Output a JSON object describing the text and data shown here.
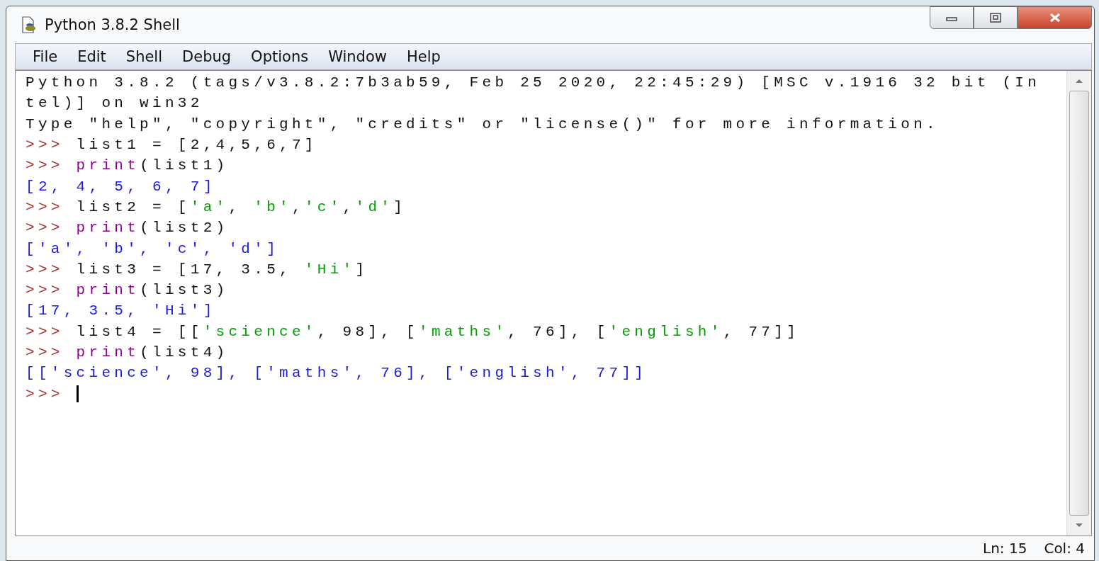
{
  "window": {
    "title": "Python 3.8.2 Shell"
  },
  "menu": [
    "File",
    "Edit",
    "Shell",
    "Debug",
    "Options",
    "Window",
    "Help"
  ],
  "shell_lines": [
    [
      {
        "kind": "plain",
        "text": "Python 3.8.2 (tags/v3.8.2:7b3ab59, Feb 25 2020, 22:45:29) [MSC v.1916 32 bit (In"
      }
    ],
    [
      {
        "kind": "plain",
        "text": "tel)] on win32"
      }
    ],
    [
      {
        "kind": "plain",
        "text": "Type \"help\", \"copyright\", \"credits\" or \"license()\" for more information."
      }
    ],
    [
      {
        "kind": "prompt",
        "text": ">>> "
      },
      {
        "kind": "plain",
        "text": "list1 = [2,4,5,6,7]"
      }
    ],
    [
      {
        "kind": "prompt",
        "text": ">>> "
      },
      {
        "kind": "builtin",
        "text": "print"
      },
      {
        "kind": "plain",
        "text": "(list1)"
      }
    ],
    [
      {
        "kind": "output",
        "text": "[2, 4, 5, 6, 7]"
      }
    ],
    [
      {
        "kind": "prompt",
        "text": ">>> "
      },
      {
        "kind": "plain",
        "text": "list2 = ["
      },
      {
        "kind": "string",
        "text": "'a'"
      },
      {
        "kind": "plain",
        "text": ", "
      },
      {
        "kind": "string",
        "text": "'b'"
      },
      {
        "kind": "plain",
        "text": ","
      },
      {
        "kind": "string",
        "text": "'c'"
      },
      {
        "kind": "plain",
        "text": ","
      },
      {
        "kind": "string",
        "text": "'d'"
      },
      {
        "kind": "plain",
        "text": "]"
      }
    ],
    [
      {
        "kind": "prompt",
        "text": ">>> "
      },
      {
        "kind": "builtin",
        "text": "print"
      },
      {
        "kind": "plain",
        "text": "(list2)"
      }
    ],
    [
      {
        "kind": "output",
        "text": "['a', 'b', 'c', 'd']"
      }
    ],
    [
      {
        "kind": "prompt",
        "text": ">>> "
      },
      {
        "kind": "plain",
        "text": "list3 = [17, 3.5, "
      },
      {
        "kind": "string",
        "text": "'Hi'"
      },
      {
        "kind": "plain",
        "text": "]"
      }
    ],
    [
      {
        "kind": "prompt",
        "text": ">>> "
      },
      {
        "kind": "builtin",
        "text": "print"
      },
      {
        "kind": "plain",
        "text": "(list3)"
      }
    ],
    [
      {
        "kind": "output",
        "text": "[17, 3.5, 'Hi']"
      }
    ],
    [
      {
        "kind": "prompt",
        "text": ">>> "
      },
      {
        "kind": "plain",
        "text": "list4 = [["
      },
      {
        "kind": "string",
        "text": "'science'"
      },
      {
        "kind": "plain",
        "text": ", 98], ["
      },
      {
        "kind": "string",
        "text": "'maths'"
      },
      {
        "kind": "plain",
        "text": ", 76], ["
      },
      {
        "kind": "string",
        "text": "'english'"
      },
      {
        "kind": "plain",
        "text": ", 77]]"
      }
    ],
    [
      {
        "kind": "prompt",
        "text": ">>> "
      },
      {
        "kind": "builtin",
        "text": "print"
      },
      {
        "kind": "plain",
        "text": "(list4)"
      }
    ],
    [
      {
        "kind": "output",
        "text": "[['science', 98], ['maths', 76], ['english', 77]]"
      }
    ],
    [
      {
        "kind": "prompt",
        "text": ">>> "
      }
    ]
  ],
  "status_bar": {
    "line": "Ln: 15",
    "column": "Col: 4"
  }
}
